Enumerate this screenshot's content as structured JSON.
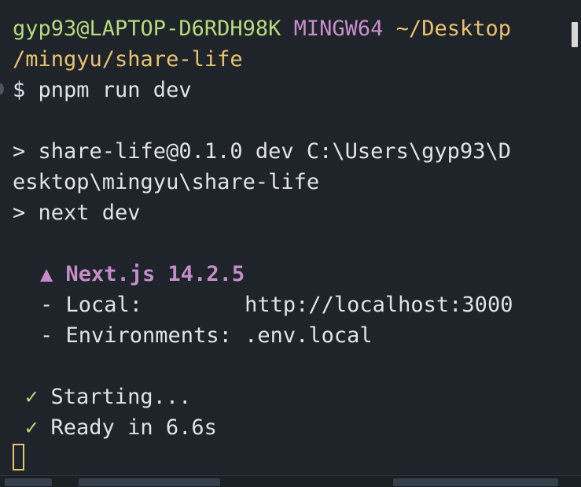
{
  "terminal": {
    "prompt": {
      "user_host": "gyp93@LAPTOP-D6RDH98K",
      "shell": "MINGW64",
      "path_part1": "~/Desktop",
      "path_part2": "/mingyu/share-life"
    },
    "command": "$ pnpm run dev",
    "script_line1": "> share-life@0.1.0 dev C:\\Users\\gyp93\\D",
    "script_line2": "esktop\\mingyu\\share-life",
    "script_line3": "> next dev",
    "next_banner": "▲ Next.js 14.2.5",
    "local_line": "- Local:        http://localhost:3000",
    "env_line": "- Environments: .env.local",
    "check_glyph": "✓",
    "starting_text": "Starting...",
    "ready_text": "Ready in 6.6s"
  },
  "colors": {
    "background": "#1e242a",
    "prompt_user": "#b7d97c",
    "prompt_shell": "#c98ec9",
    "prompt_path": "#e9c26e",
    "next_banner": "#c58cc9",
    "check": "#b7d97c",
    "text": "#dfe3e6"
  }
}
